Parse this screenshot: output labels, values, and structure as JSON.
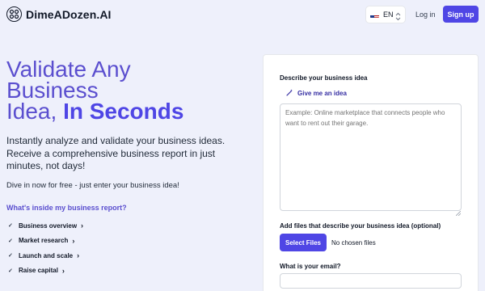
{
  "header": {
    "brand": "DimeADozen.AI",
    "language": {
      "code": "EN",
      "flag": "us-flag-icon"
    },
    "login_label": "Log in",
    "signup_label": "Sign up"
  },
  "hero": {
    "title_line1": "Validate Any",
    "title_line2": "Business",
    "title_line3_regular": "Idea, ",
    "title_line3_strong": "In Seconds",
    "subtitle": "Instantly analyze and validate your business ideas. Receive a comprehensive business report in just minutes, not days!",
    "free_note": "Dive in now for free - just enter your business idea!",
    "report_heading": "What's inside my business report?",
    "report_items": [
      {
        "label": "Business overview"
      },
      {
        "label": "Market research"
      },
      {
        "label": "Launch and scale"
      },
      {
        "label": "Raise capital"
      }
    ]
  },
  "form": {
    "idea_label": "Describe your business idea",
    "give_idea_label": "Give me an idea",
    "idea_placeholder": "Example: Online marketplace that connects people who want to rent out their garage.",
    "idea_value": "",
    "files_label": "Add files that describe your business idea (optional)",
    "select_files_label": "Select Files",
    "no_files_text": "No chosen files",
    "email_label": "What is your email?",
    "email_value": ""
  },
  "colors": {
    "accent": "#4f46e5",
    "hero_title": "#5b4fcf",
    "background": "#eef0fb"
  }
}
